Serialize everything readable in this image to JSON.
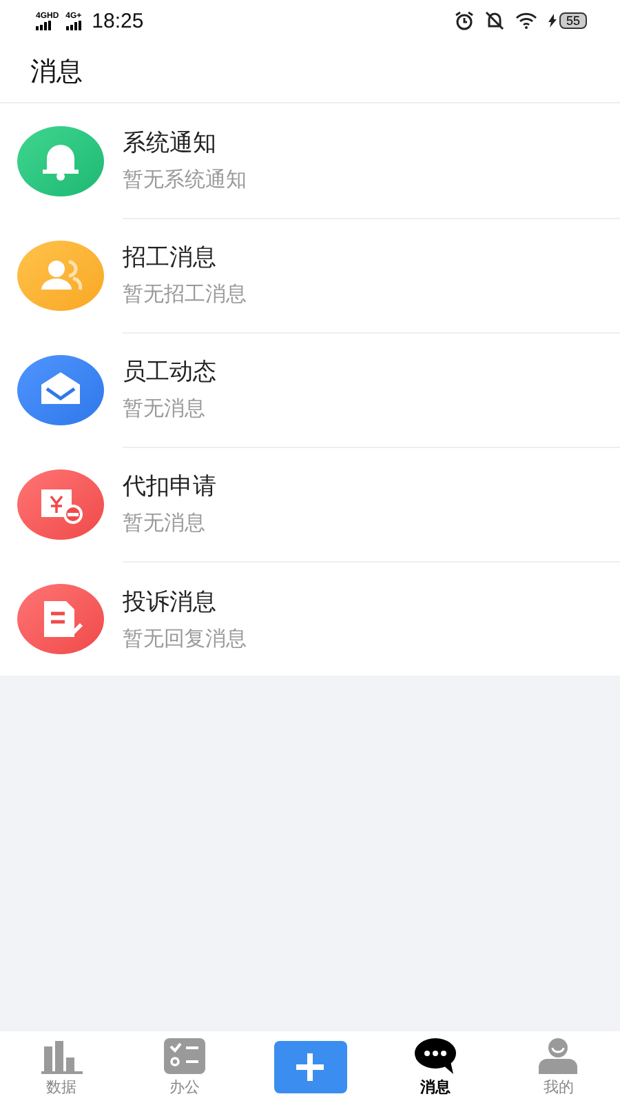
{
  "status_bar": {
    "networks": [
      "4GHD",
      "4G+"
    ],
    "time": "18:25",
    "battery": "55"
  },
  "header": {
    "title": "消息"
  },
  "messages": [
    {
      "kind": "bell",
      "title": "系统通知",
      "subtitle": "暂无系统通知"
    },
    {
      "kind": "people",
      "title": "招工消息",
      "subtitle": "暂无招工消息"
    },
    {
      "kind": "mail",
      "title": "员工动态",
      "subtitle": "暂无消息"
    },
    {
      "kind": "money",
      "title": "代扣申请",
      "subtitle": "暂无消息"
    },
    {
      "kind": "complaint",
      "title": "投诉消息",
      "subtitle": "暂无回复消息"
    }
  ],
  "tab_bar": [
    {
      "kind": "chart",
      "label": "数据",
      "selected": false
    },
    {
      "kind": "tasks",
      "label": "办公",
      "selected": false
    },
    {
      "kind": "add",
      "selected": false
    },
    {
      "kind": "chat",
      "label": "消息",
      "selected": true
    },
    {
      "kind": "person",
      "label": "我的",
      "selected": false
    }
  ]
}
